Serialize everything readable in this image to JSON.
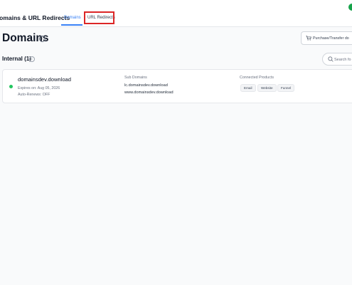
{
  "header": {
    "app_title": "Domains & URL Redirects",
    "tabs": [
      {
        "label": "Domains",
        "active": true
      },
      {
        "label": "URL Redirects",
        "active": false
      }
    ],
    "status_color": "#16a34a"
  },
  "page": {
    "title": "Domains",
    "help_icon": "question-circle-icon",
    "purchase_button": "Purchase/Transfer do",
    "cart_icon": "cart-icon"
  },
  "section": {
    "title": "Internal (1)",
    "info_icon": "info-circle-icon",
    "search": {
      "placeholder": "Search fo",
      "icon": "search-icon"
    }
  },
  "domains": [
    {
      "name": "domainsdev.download",
      "status_color": "#22c55e",
      "expires": "Expires on: Aug 05, 2026",
      "auto_renew": "Auto-Renews: OFF",
      "sub_domains_label": "Sub Domains",
      "sub_domains": [
        "lc.domainsdev.download",
        "www.domainsdev.download"
      ],
      "products_label": "Connected Products",
      "products": [
        "Email",
        "Website",
        "Funnel"
      ]
    }
  ],
  "accent_color": "#3b82f6",
  "highlight_color": "#dc2626"
}
